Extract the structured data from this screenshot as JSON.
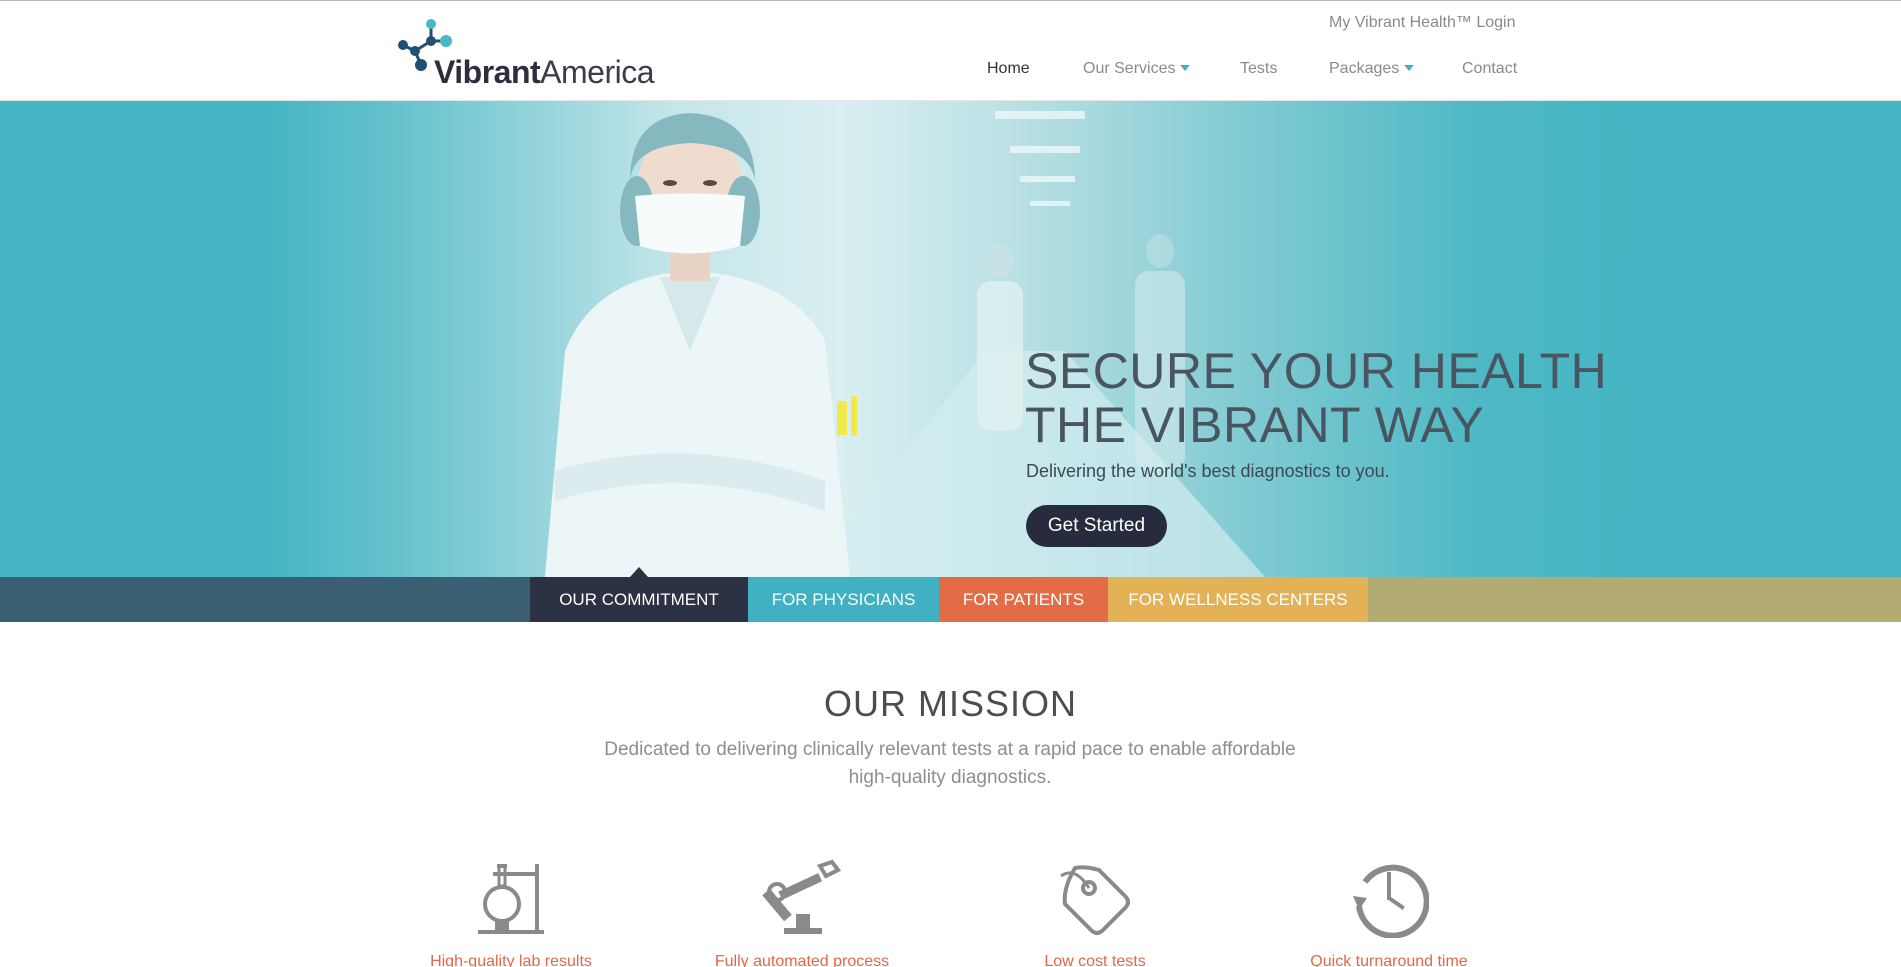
{
  "brand": {
    "name_bold": "Vibrant",
    "name_light": "America"
  },
  "header": {
    "login": "My Vibrant Health™ Login",
    "nav": [
      {
        "label": "Home"
      },
      {
        "label": "Our Services"
      },
      {
        "label": "Tests"
      },
      {
        "label": "Packages"
      },
      {
        "label": "Contact"
      }
    ]
  },
  "hero": {
    "title_line1": "SECURE YOUR HEALTH",
    "title_line2": "THE VIBRANT WAY",
    "subtitle": "Delivering the world's best diagnostics to you.",
    "cta": "Get Started"
  },
  "tabs": [
    {
      "label": "OUR COMMITMENT",
      "color": "#2c3244"
    },
    {
      "label": "FOR PHYSICIANS",
      "color": "#3fb1c2"
    },
    {
      "label": "FOR PATIENTS",
      "color": "#e36b46"
    },
    {
      "label": "FOR WELLNESS CENTERS",
      "color": "#e3b156"
    }
  ],
  "mission": {
    "title": "OUR MISSION",
    "text_line1": "Dedicated to delivering clinically relevant tests at a rapid pace to enable affordable",
    "text_line2": "high-quality diagnostics."
  },
  "features": [
    {
      "icon": "lab-flask-icon",
      "label": "High-quality lab results"
    },
    {
      "icon": "robotic-arm-icon",
      "label": "Fully automated process"
    },
    {
      "icon": "price-tag-icon",
      "label": "Low cost tests"
    },
    {
      "icon": "history-clock-icon",
      "label": "Quick turnaround time"
    }
  ],
  "colors": {
    "accent": "#3fb1c2",
    "hero_background": "#45b5c3",
    "feature_label": "#e2674a",
    "button": "#262b3d"
  }
}
